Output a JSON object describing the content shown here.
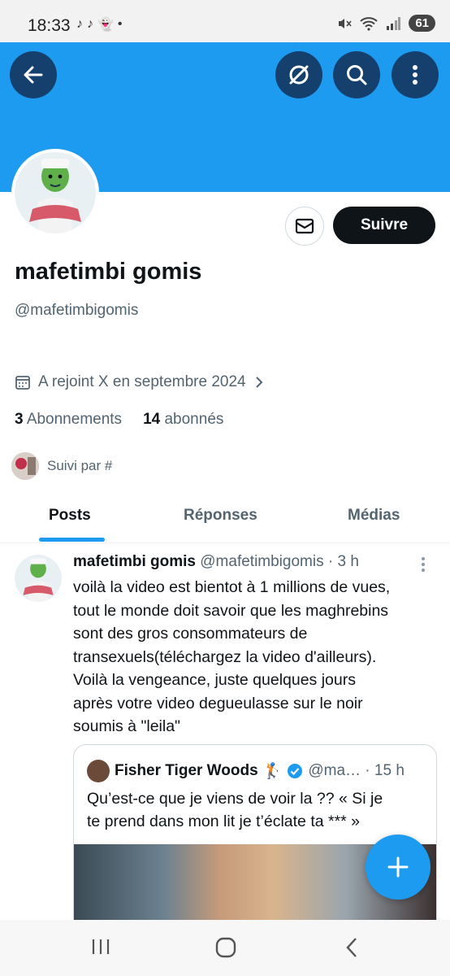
{
  "status": {
    "time": "18:33",
    "battery": "61"
  },
  "profile": {
    "name": "mafetimbi gomis",
    "handle": "@mafetimbigomis",
    "joined": "A rejoint X en septembre 2024",
    "following_count": "3",
    "following_label": "Abonnements",
    "followers_count": "14",
    "followers_label": "abonnés",
    "followed_by": "Suivi par #",
    "follow_label": "Suivre"
  },
  "tabs": [
    "Posts",
    "Réponses",
    "Médias"
  ],
  "post": {
    "author": "mafetimbi gomis",
    "handle_time": "@mafetimbigomis · 3 h",
    "lines": [
      "voilà la video est bientot à 1 millions de vues,",
      "tout le monde doit savoir que les maghrebins",
      "sont des gros consommateurs de",
      "transexuels(téléchargez la video d'ailleurs).",
      "Voilà la vengeance, juste quelques jours",
      "après votre video degueulasse sur le noir",
      "soumis à \"leila\""
    ]
  },
  "quote": {
    "author": "Fisher Tiger Woods",
    "emoji": "🏌",
    "handle_time": "@ma… · 15 h",
    "lines": [
      "Qu’est-ce que je viens de voir la ?? « Si je",
      "te prend dans mon lit je t’éclate ta *** »"
    ]
  },
  "colors": {
    "accent": "#1d9bf0",
    "banner": "#1d9bf0",
    "dark": "#0f1419",
    "muted": "#536471"
  }
}
